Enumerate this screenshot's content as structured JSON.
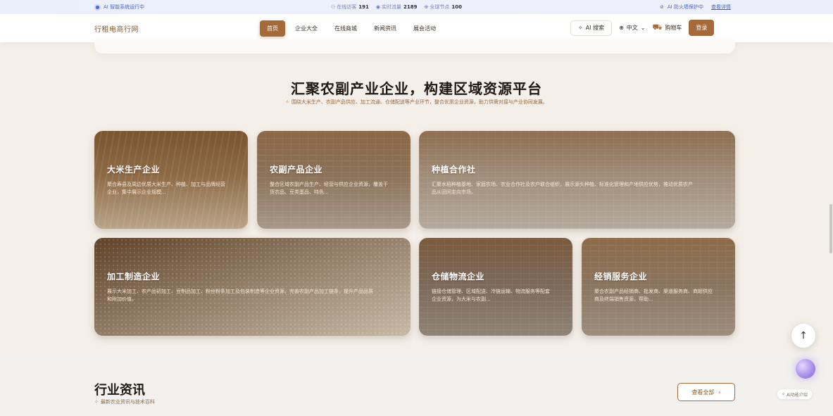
{
  "topbar": {
    "status": "AI 智能系统运行中",
    "online_label": "在线访客",
    "online_value": "191",
    "traffic_label": "实时流量",
    "traffic_value": "2189",
    "nodes_label": "全球节点",
    "nodes_value": "100",
    "firewall": "AI 防火墙保护中",
    "details_link": "查看详情"
  },
  "header": {
    "brand": "行租电商行网",
    "nav": [
      "首页",
      "企业大全",
      "在线商城",
      "新闻资讯",
      "展会活动"
    ],
    "ai_search": "AI 搜索",
    "language": "中文",
    "cart": "购物车",
    "login": "登录"
  },
  "section": {
    "title": "汇聚农副产业企业，构建区域资源平台",
    "subtitle": "围绕大米生产、农副产品供应、加工流通、仓储配送等产业环节，整合优质企业资源，助力供需对接与产业协同发展。"
  },
  "cards": [
    {
      "title": "大米生产企业",
      "desc": "聚合寿县及周边优质大米生产、种植、加工与品牌经营企业，集中展示企业规模..."
    },
    {
      "title": "农副产品企业",
      "desc": "整合区域农副产品生产、经营与供应企业资源，覆盖干货农品、豆类蛋品、特色..."
    },
    {
      "title": "种植合作社",
      "desc": "汇聚水稻种植基地、家庭农场、农业合作社及农户联合组织，展示源头种植、标准化管理和产地供应优势，推动优质农产品从田间走向市场。"
    },
    {
      "title": "加工制造企业",
      "desc": "展示大米加工、农产品初加工、豆制品加工、粉丝粉条加工及包装制造等企业资源，完善农副产品加工链条，提升产品品质和附加价值。"
    },
    {
      "title": "仓储物流企业",
      "desc": "链接仓储管理、区域配送、冷链运输、物流服务等配套企业资源，为大米与农副..."
    },
    {
      "title": "经销服务企业",
      "desc": "聚合农副产品经销商、批发商、渠道服务商、商超供应商及终端销售资源，帮助..."
    }
  ],
  "news": {
    "title": "行业资讯",
    "subtitle": "最新农业资讯与技术百科",
    "view_all": "查看全部"
  },
  "widgets": {
    "ai_intro": "AI功能介绍"
  },
  "colors": {
    "accent": "#a56a3a",
    "topbar_text": "#4b62c9"
  }
}
